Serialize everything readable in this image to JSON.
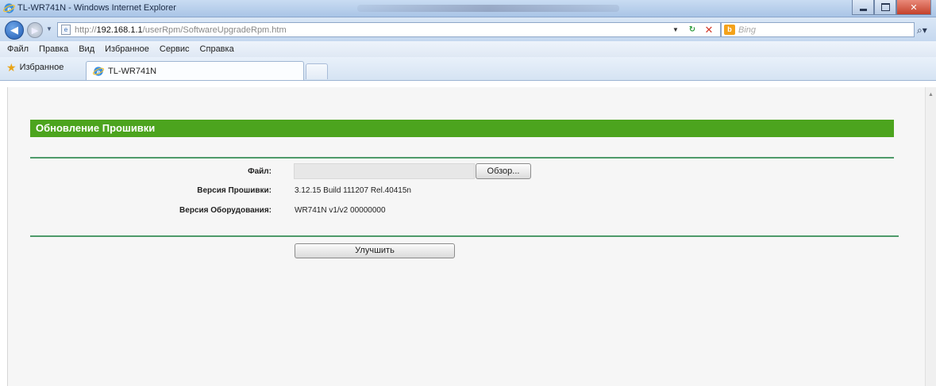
{
  "window": {
    "title": "TL-WR741N - Windows Internet Explorer"
  },
  "address_bar": {
    "url_scheme": "http://",
    "url_host": "192.168.1.1",
    "url_path": "/userRpm/SoftwareUpgradeRpm.htm"
  },
  "search": {
    "engine_label": "Bing",
    "bing_icon_glyph": "b"
  },
  "menu": {
    "items": [
      "Файл",
      "Правка",
      "Вид",
      "Избранное",
      "Сервис",
      "Справка"
    ]
  },
  "favorites": {
    "label": "Избранное"
  },
  "tabs": [
    {
      "label": "TL-WR741N"
    }
  ],
  "page": {
    "header": "Обновление Прошивки",
    "file_label": "Файл:",
    "browse_button": "Обзор...",
    "firmware_label": "Версия Прошивки:",
    "firmware_value": "3.12.15 Build 111207 Rel.40415n",
    "hardware_label": "Версия Оборудования:",
    "hardware_value": "WR741N v1/v2 00000000",
    "upgrade_button": "Улучшить"
  },
  "colors": {
    "header_green": "#4ca41e",
    "rule_green": "#4e9a6a",
    "content_bg": "#f6f6f6"
  },
  "icons": {
    "app": "ie-logo-icon",
    "back": "back-arrow-icon",
    "forward": "forward-arrow-icon",
    "refresh": "refresh-icon",
    "stop": "stop-icon",
    "search": "search-magnifier-icon",
    "favorites": "star-icon"
  }
}
